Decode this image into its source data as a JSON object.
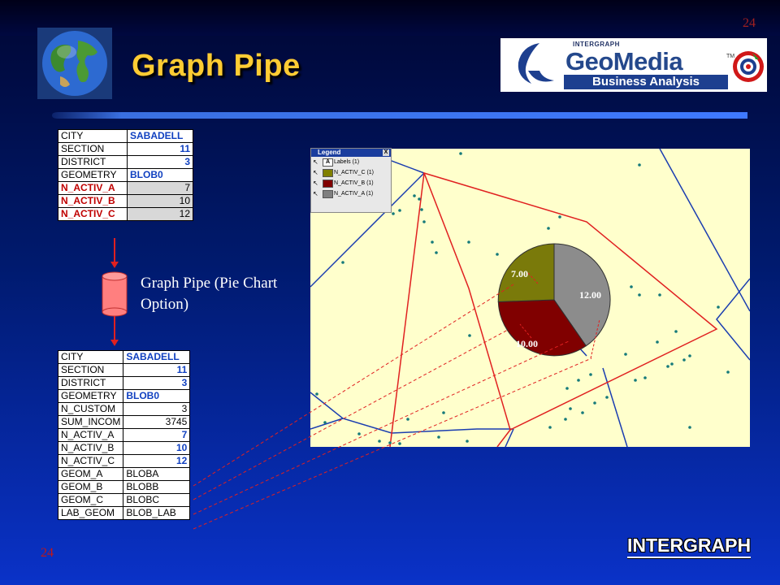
{
  "slide": {
    "title": "Graph Pipe",
    "page_number": "24",
    "pipe_label": "Graph Pipe (Pie Chart Option)",
    "footer_brand": "INTERGRAPH"
  },
  "logo": {
    "maker": "INTERGRAPH",
    "product": "GeoMedia",
    "subtitle": "Business Analysis",
    "trademark": "TM"
  },
  "table_top": [
    {
      "key": "CITY",
      "value": "SABADELL"
    },
    {
      "key": "SECTION",
      "value": "11"
    },
    {
      "key": "DISTRICT",
      "value": "3"
    },
    {
      "key": "GEOMETRY",
      "value": "BLOB0"
    },
    {
      "key": "N_ACTIV_A",
      "value": "7"
    },
    {
      "key": "N_ACTIV_B",
      "value": "10"
    },
    {
      "key": "N_ACTIV_C",
      "value": "12"
    }
  ],
  "table_bottom": [
    {
      "key": "CITY",
      "value": "SABADELL"
    },
    {
      "key": "SECTION",
      "value": "11"
    },
    {
      "key": "DISTRICT",
      "value": "3"
    },
    {
      "key": "GEOMETRY",
      "value": "BLOB0"
    },
    {
      "key": "N_CUSTOM",
      "value": "3"
    },
    {
      "key": "SUM_INCOM",
      "value": "3745"
    },
    {
      "key": "N_ACTIV_A",
      "value": "7"
    },
    {
      "key": "N_ACTIV_B",
      "value": "10"
    },
    {
      "key": "N_ACTIV_C",
      "value": "12"
    },
    {
      "key": "GEOM_A",
      "value": "BLOBA"
    },
    {
      "key": "GEOM_B",
      "value": "BLOBB"
    },
    {
      "key": "GEOM_C",
      "value": "BLOBC"
    },
    {
      "key": "LAB_GEOM",
      "value": "BLOB_LAB"
    }
  ],
  "legend": {
    "title": "Legend",
    "close": "X",
    "items": [
      {
        "label": "Labels  (1)",
        "swatch": "A",
        "color": "#ffffff"
      },
      {
        "label": "N_ACTIV_C  (1)",
        "color": "#808000"
      },
      {
        "label": "N_ACTIV_B  (1)",
        "color": "#800000"
      },
      {
        "label": "N_ACTIV_A  (1)",
        "color": "#808080"
      }
    ]
  },
  "pie": {
    "colors": {
      "A": "#8c8c8c",
      "B": "#800000",
      "C": "#7a7a0a"
    },
    "label_A": "12.00",
    "label_B": "10.00",
    "label_C": "7.00"
  },
  "colors": {
    "title": "#ffcc33",
    "boundary_red": "#e02020",
    "boundary_blue": "#1a3db0",
    "map_background": "#ffffcc",
    "point_teal": "#157a7a"
  }
}
